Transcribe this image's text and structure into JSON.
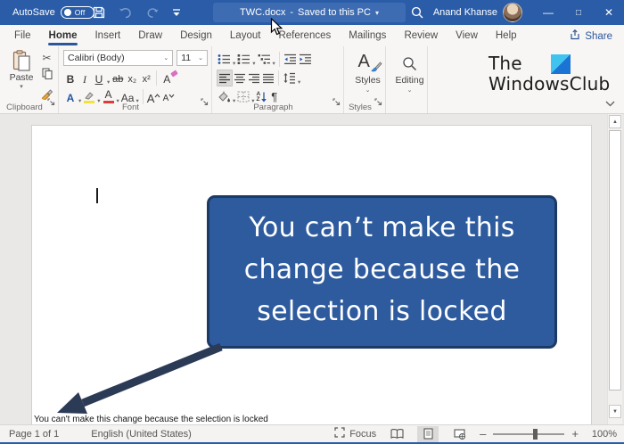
{
  "titlebar": {
    "autosave_label": "AutoSave",
    "autosave_state": "Off",
    "doc_title": "TWC.docx",
    "separator": "-",
    "doc_status": "Saved to this PC",
    "user_name": "Anand Khanse"
  },
  "icons": {
    "dropdown_caret": "▾",
    "chevron_small": "⌄",
    "minimize": "—",
    "maximize": "□",
    "close": "✕",
    "tri_up": "▲",
    "tri_down": "▼",
    "scissors": "✂",
    "pilcrow": "¶"
  },
  "tabs": [
    {
      "label": "File"
    },
    {
      "label": "Home"
    },
    {
      "label": "Insert"
    },
    {
      "label": "Draw"
    },
    {
      "label": "Design"
    },
    {
      "label": "Layout"
    },
    {
      "label": "References"
    },
    {
      "label": "Mailings"
    },
    {
      "label": "Review"
    },
    {
      "label": "View"
    },
    {
      "label": "Help"
    }
  ],
  "share_label": "Share",
  "ribbon": {
    "clipboard": {
      "paste_label": "Paste",
      "group_label": "Clipboard"
    },
    "font": {
      "group_label": "Font",
      "font_name": "Calibri (Body)",
      "font_size": "11",
      "bold": "B",
      "italic": "I",
      "underline": "U",
      "strike": "ab",
      "subscript": "x₂",
      "superscript": "x²",
      "clear_format": "A",
      "text_effects": "A",
      "font_color": "A",
      "change_case": "Aa",
      "grow_font": "A",
      "shrink_font": "A"
    },
    "paragraph": {
      "group_label": "Paragraph",
      "sort_a": "A",
      "sort_z": "Z"
    },
    "styles": {
      "icon_letter": "A",
      "button_label": "Styles",
      "group_label": "Styles"
    },
    "editing": {
      "button_label": "Editing"
    },
    "logo": {
      "line1": "The",
      "line2": "WindowsClub"
    }
  },
  "document": {
    "callout_lines": [
      "You can’t make this",
      "change because the",
      "selection is locked"
    ],
    "caption": "You can't make this change because the selection is locked"
  },
  "statusbar": {
    "page_indicator": "Page 1 of 1",
    "language": "English (United States)",
    "focus_label": "Focus",
    "zoom_minus": "–",
    "zoom_plus": "+",
    "zoom_level": "100%"
  },
  "colors": {
    "titlebar_blue": "#2a5ca8",
    "accent_blue": "#2b579a",
    "callout_fill": "#2e5b9e",
    "callout_border": "#1c3a66",
    "arrow_navy": "#2b3a55",
    "logo_light_blue": "#41c3f0",
    "logo_dark_blue": "#1b74d3"
  }
}
